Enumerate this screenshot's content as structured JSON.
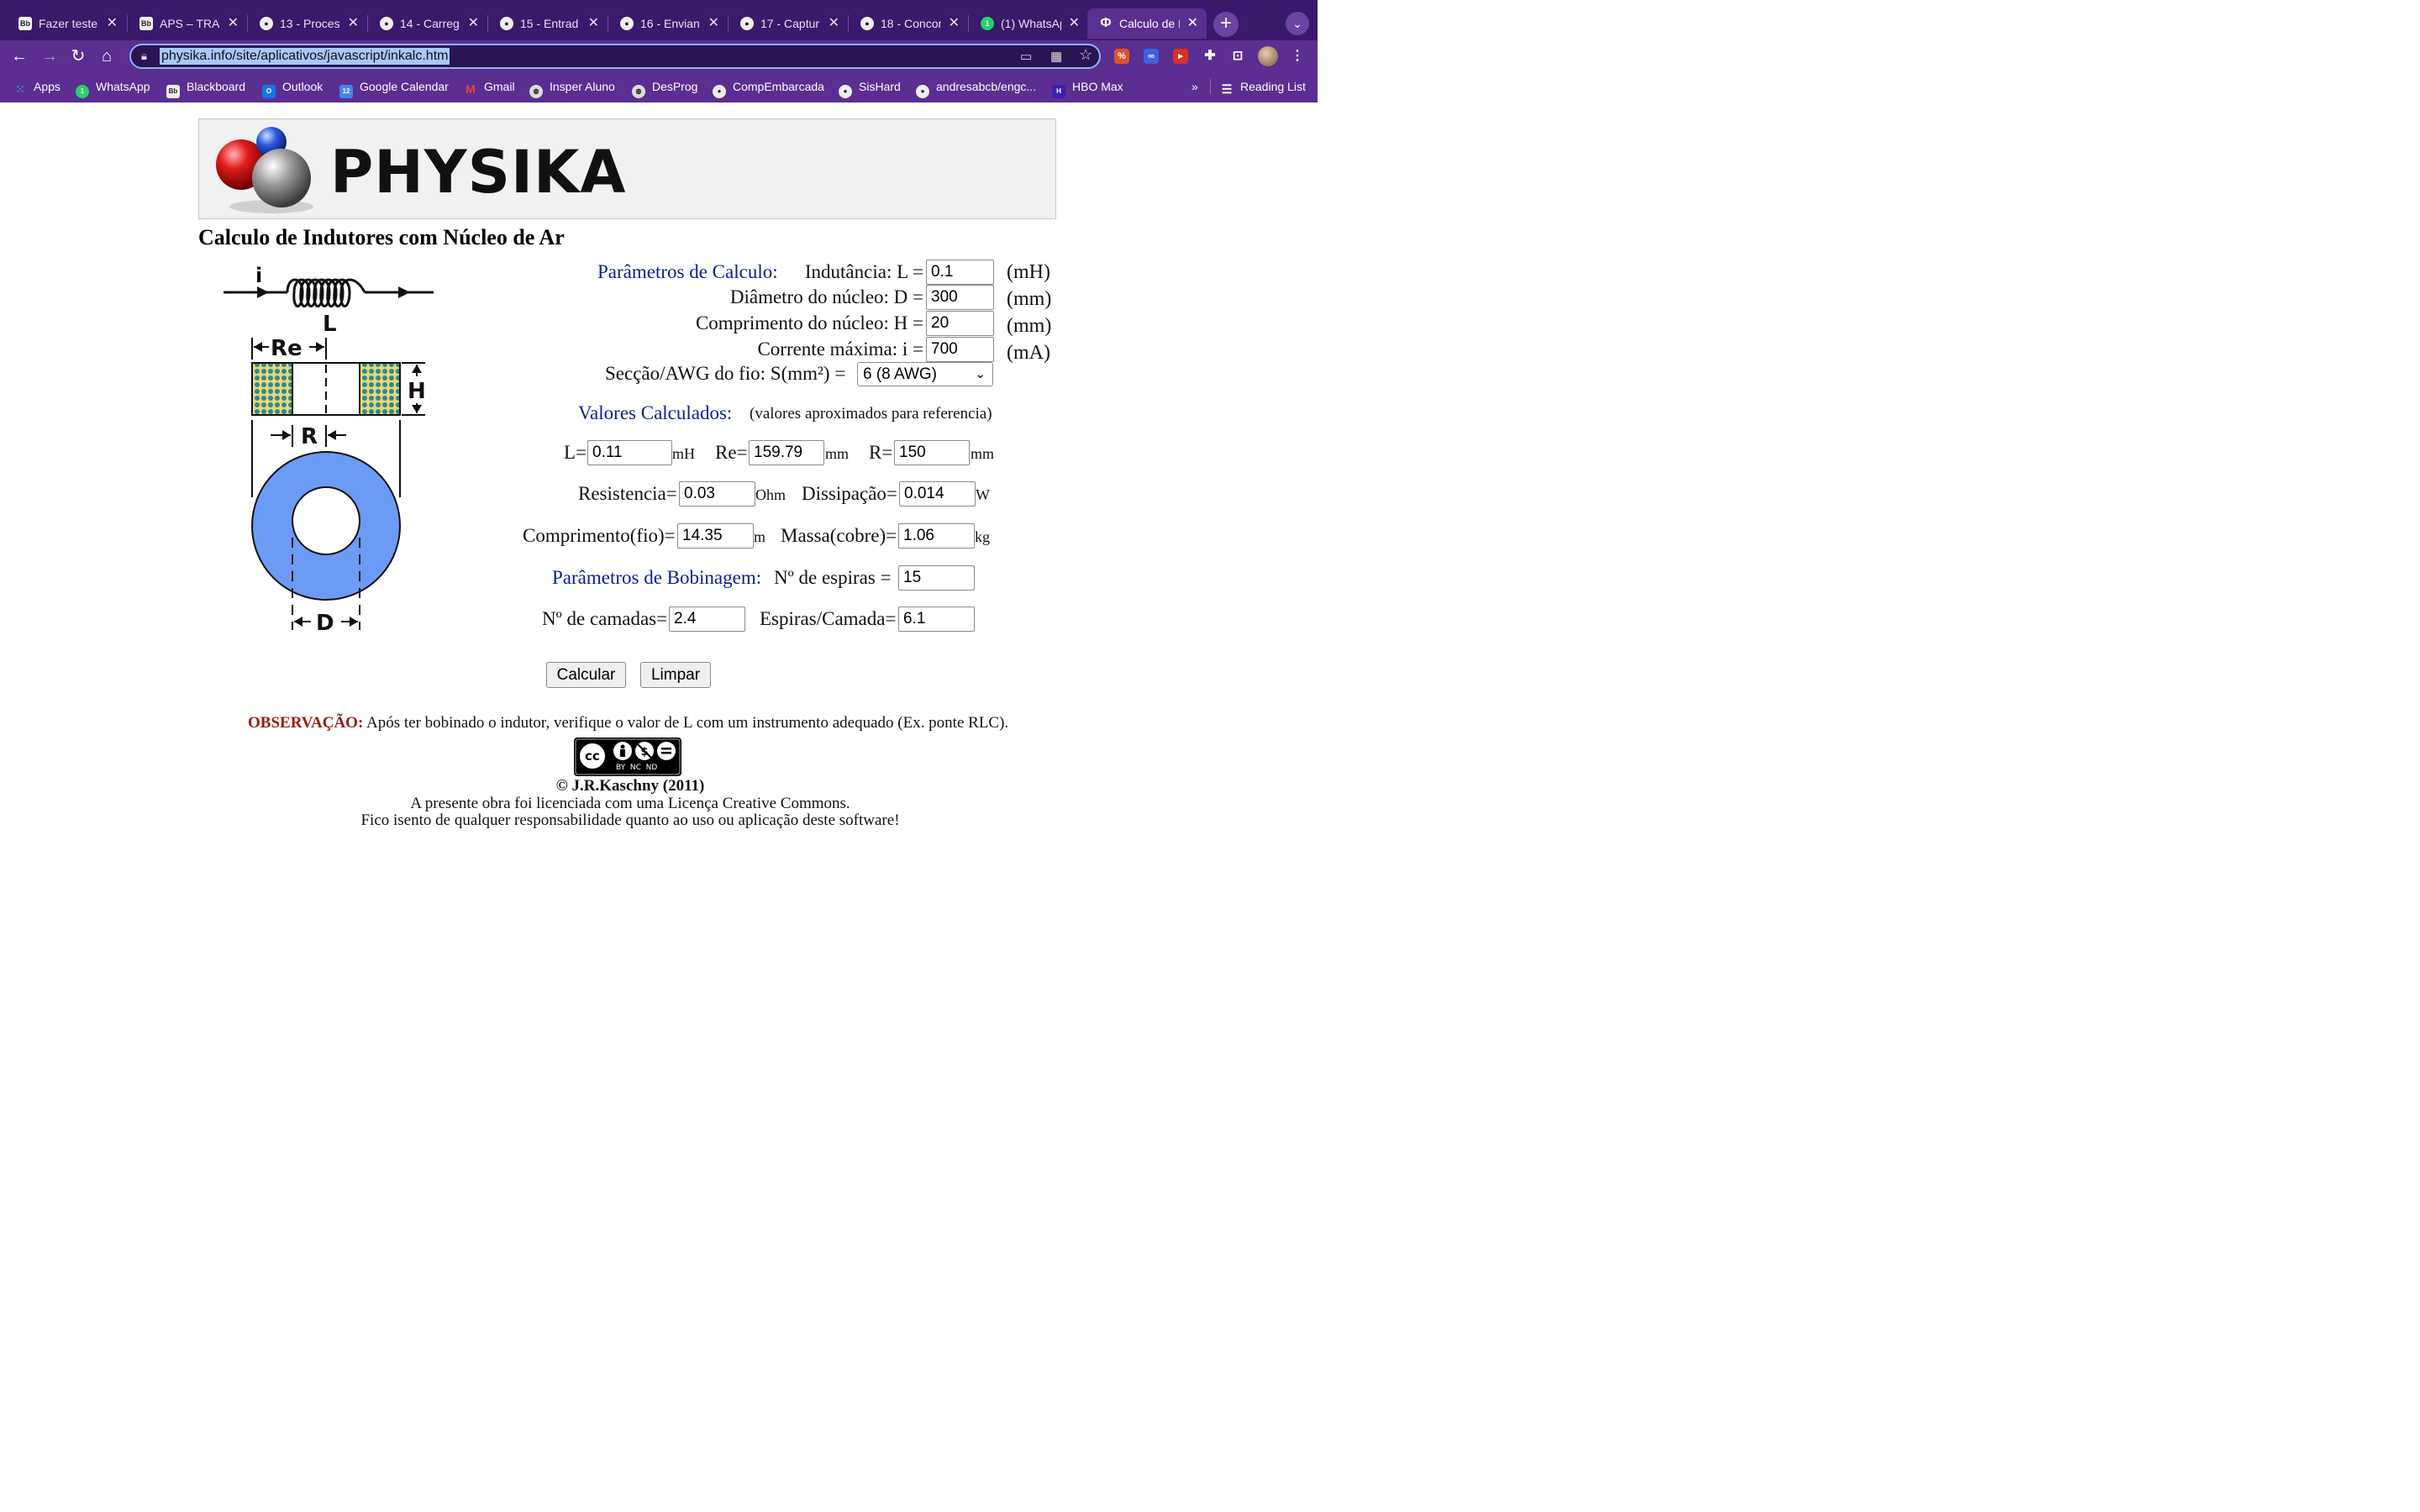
{
  "browser": {
    "tabs": [
      {
        "title": "Fazer teste",
        "favicon": "Bb"
      },
      {
        "title": "APS – TRAN",
        "favicon": "Bb"
      },
      {
        "title": "13 - Proces",
        "favicon": "github-icon"
      },
      {
        "title": "14 - Carreg",
        "favicon": "github-icon"
      },
      {
        "title": "15 - Entrad",
        "favicon": "github-icon"
      },
      {
        "title": "16 - Envian",
        "favicon": "github-icon"
      },
      {
        "title": "17 - Captur",
        "favicon": "github-icon"
      },
      {
        "title": "18 - Concor",
        "favicon": "github-icon"
      },
      {
        "title": "(1) WhatsAp",
        "favicon": "whatsapp-icon"
      },
      {
        "title": "Calculo de I",
        "favicon": "Φ"
      }
    ],
    "active_tab_index": 9,
    "url": "physika.info/site/aplicativos/javascript/inkalc.htm",
    "bookmarks": [
      {
        "label": "Apps",
        "icon": "apps-grid-icon"
      },
      {
        "label": "WhatsApp",
        "icon": "whatsapp-icon"
      },
      {
        "label": "Blackboard",
        "icon": "Bb"
      },
      {
        "label": "Outlook",
        "icon": "outlook-icon"
      },
      {
        "label": "Google Calendar",
        "icon": "12"
      },
      {
        "label": "Gmail",
        "icon": "gmail-icon"
      },
      {
        "label": "Insper Aluno",
        "icon": "globe-icon"
      },
      {
        "label": "DesProg",
        "icon": "globe-icon"
      },
      {
        "label": "CompEmbarcada",
        "icon": "github-icon"
      },
      {
        "label": "SisHard",
        "icon": "github-icon"
      },
      {
        "label": "andresabcb/engc...",
        "icon": "github-icon"
      },
      {
        "label": "HBO Max",
        "icon": "hbo-icon"
      }
    ],
    "overflow_label": "»",
    "reading_list": "Reading List",
    "accent_color": "#5b2e91"
  },
  "page": {
    "logo": "PHYSIKA",
    "title": "Calculo de Indutores com Núcleo de Ar",
    "diagram_labels": {
      "current": "i",
      "inductance": "L",
      "outer_radius": "Re",
      "height": "H",
      "inner_radius": "R",
      "diameter": "D"
    },
    "params": {
      "heading": "Parâmetros de Calculo:",
      "inductance": {
        "label": "Indutância: L =",
        "value": "0.1",
        "unit": "(mH)"
      },
      "diameter": {
        "label": "Diâmetro do núcleo: D =",
        "value": "300",
        "unit": "(mm)"
      },
      "length": {
        "label": "Comprimento do núcleo: H =",
        "value": "20",
        "unit": "(mm)"
      },
      "current": {
        "label": "Corrente máxima: i =",
        "value": "700",
        "unit": "(mA)"
      },
      "wire": {
        "label": "Secção/AWG do fio: S(mm²) =",
        "selected": "6 (8 AWG)"
      }
    },
    "calculated": {
      "heading": "Valores Calculados:",
      "note": "(valores aproximados para referencia)",
      "L": {
        "label": "L=",
        "value": "0.11",
        "unit": "mH"
      },
      "Re": {
        "label": "Re=",
        "value": "159.79",
        "unit": "mm"
      },
      "R": {
        "label": "R=",
        "value": "150",
        "unit": "mm"
      },
      "resistance": {
        "label": "Resistencia=",
        "value": "0.03",
        "unit": "Ohm"
      },
      "dissipation": {
        "label": "Dissipação=",
        "value": "0.014",
        "unit": "W"
      },
      "wire_length": {
        "label": "Comprimento(fio)=",
        "value": "14.35",
        "unit": "m"
      },
      "mass": {
        "label": "Massa(cobre)=",
        "value": "1.06",
        "unit": "kg"
      }
    },
    "winding": {
      "heading": "Parâmetros de Bobinagem:",
      "turns": {
        "label": "Nº de espiras =",
        "value": "15"
      },
      "layers": {
        "label": "Nº de camadas=",
        "value": "2.4"
      },
      "turns_per_layer": {
        "label": "Espiras/Camada=",
        "value": "6.1"
      }
    },
    "buttons": {
      "calculate": "Calcular",
      "clear": "Limpar"
    },
    "observation": {
      "label": "OBSERVAÇÃO:",
      "text": "Após ter bobinado o indutor, verifique o valor de L com um instrumento adequado (Ex. ponte RLC)."
    },
    "license_badge": {
      "cc": "cc",
      "terms": "BY  NC  ND"
    },
    "copyright": "© J.R.Kaschny (2011)",
    "license_text": "A presente obra foi licenciada com uma Licença Creative Commons.",
    "disclaimer": "Fico isento de qualquer responsabilidade quanto ao uso ou aplicação deste software!"
  }
}
